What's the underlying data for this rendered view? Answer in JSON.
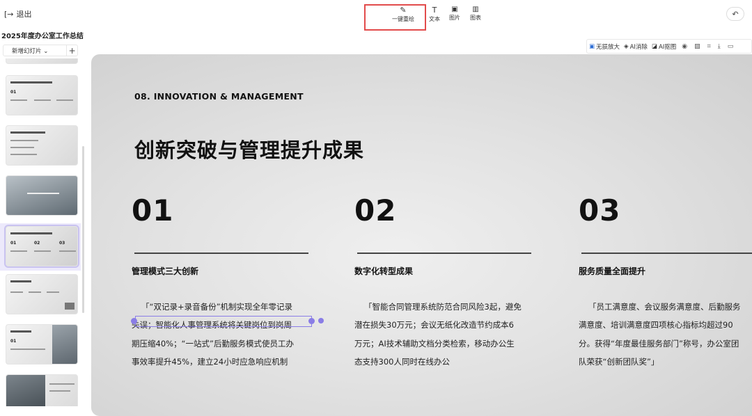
{
  "header": {
    "exit_label": "退出",
    "doc_title": "2025年度办公室工作总结",
    "new_slide_label": "新增幻灯片",
    "add_label": "+",
    "undo_icon": "undo-icon"
  },
  "toolbar": {
    "tools": [
      {
        "label": "一键重绘",
        "icon": "magic-brush-icon"
      },
      {
        "label": "文本",
        "icon": "text-icon"
      },
      {
        "label": "图片",
        "icon": "image-icon"
      },
      {
        "label": "图表",
        "icon": "chart-icon"
      }
    ],
    "highlight_color": "#e24b4b"
  },
  "ai_toolbar": {
    "items": [
      {
        "label": "无损放大",
        "icon": "upscale-icon"
      },
      {
        "label": "AI消除",
        "icon": "eraser-icon"
      },
      {
        "label": "AI抠图",
        "icon": "cutout-icon"
      }
    ],
    "extra_icons": [
      "locate-icon",
      "replace-image-icon",
      "crop-icon",
      "download-icon",
      "more-icon"
    ]
  },
  "slide": {
    "subtitle": "08. INNOVATION & MANAGEMENT",
    "title": "创新突破与管理提升成果",
    "columns": [
      {
        "num": "01",
        "head": "管理模式三大创新",
        "body": "「“双记录+录音备份”机制实现全年零记录失误；智能化人事管理系统将关键岗位到岗周期压缩40%；“一站式”后勤服务模式使员工办事效率提升45%，建立24小时应急响应机制"
      },
      {
        "num": "02",
        "head": "数字化转型成果",
        "body": "「智能合同管理系统防范合同风险3起，避免潜在损失30万元；会议无纸化改造节约成本6万元；AI技术辅助文档分类检索，移动办公生态支持300人同时在线办公"
      },
      {
        "num": "03",
        "head": "服务质量全面提升",
        "body": "「员工满意度、会议服务满意度、后勤服务满意度、培训满意度四项核心指标均超过90分。获得“年度最佳服务部门”称号，办公室团队荣获“创新团队奖”」"
      }
    ]
  },
  "colors": {
    "selection": "#8a7de6",
    "selected_thumb_bg": "#ece9fb"
  }
}
